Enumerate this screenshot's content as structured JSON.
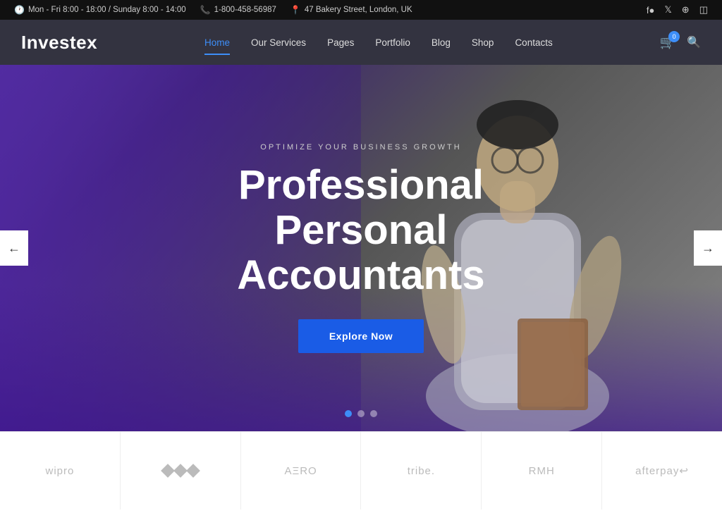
{
  "topbar": {
    "hours": "Mon - Fri 8:00 - 18:00 / Sunday 8:00 - 14:00",
    "phone": "1-800-458-56987",
    "address": "47 Bakery Street, London, UK"
  },
  "header": {
    "logo": "Investex",
    "nav": [
      {
        "label": "Home",
        "active": true
      },
      {
        "label": "Our Services",
        "active": false
      },
      {
        "label": "Pages",
        "active": false
      },
      {
        "label": "Portfolio",
        "active": false
      },
      {
        "label": "Blog",
        "active": false
      },
      {
        "label": "Shop",
        "active": false
      },
      {
        "label": "Contacts",
        "active": false
      }
    ],
    "cart_count": "0"
  },
  "hero": {
    "subtitle": "OPTIMIZE YOUR BUSINESS GROWTH",
    "title_line1": "Professional Personal",
    "title_line2": "Accountants",
    "cta_label": "Explore Now",
    "dots": [
      {
        "active": true
      },
      {
        "active": false
      },
      {
        "active": false
      }
    ]
  },
  "partners": [
    {
      "name": "wipro",
      "type": "text"
    },
    {
      "name": "◆◆◆",
      "type": "diamonds"
    },
    {
      "name": "AΞRO",
      "type": "text"
    },
    {
      "name": "tribe.",
      "type": "text"
    },
    {
      "name": "RMH",
      "type": "text"
    },
    {
      "name": "afterpay↩",
      "type": "text"
    }
  ],
  "arrows": {
    "prev": "←",
    "next": "→"
  }
}
